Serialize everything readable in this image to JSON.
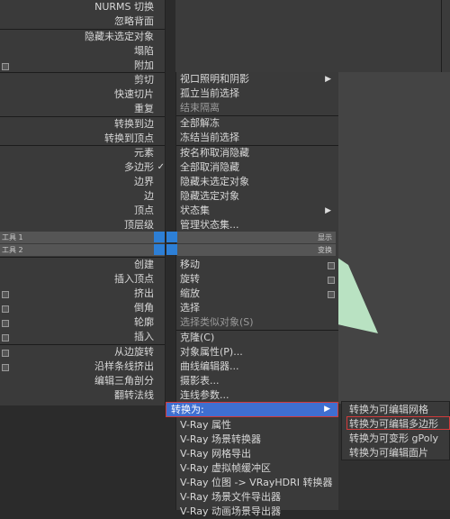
{
  "left_menu": {
    "items": [
      {
        "label": "NURMS 切换",
        "has_box": false
      },
      {
        "label": "忽略背面",
        "has_box": false
      },
      {
        "label": "隐藏未选定对象",
        "has_box": false
      },
      {
        "label": "塌陷",
        "has_box": false
      },
      {
        "label": "附加",
        "has_box": true
      },
      {
        "label": "剪切",
        "has_box": false
      },
      {
        "label": "快速切片",
        "has_box": false
      },
      {
        "label": "重复",
        "has_box": false
      },
      {
        "label": "转换到边",
        "has_box": false
      },
      {
        "label": "转换到顶点",
        "has_box": false
      },
      {
        "label": "元素",
        "has_box": false
      },
      {
        "label": "多边形",
        "has_box": false,
        "checked": true
      },
      {
        "label": "边界",
        "has_box": false
      },
      {
        "label": "边",
        "has_box": false
      },
      {
        "label": "顶点",
        "has_box": false
      },
      {
        "label": "顶层级",
        "has_box": false
      },
      {
        "label": "创建",
        "has_box": false
      },
      {
        "label": "插入顶点",
        "has_box": false
      },
      {
        "label": "挤出",
        "has_box": true
      },
      {
        "label": "倒角",
        "has_box": true
      },
      {
        "label": "轮廓",
        "has_box": true
      },
      {
        "label": "插入",
        "has_box": true
      },
      {
        "label": "从边旋转",
        "has_box": true
      },
      {
        "label": "沿样条线挤出",
        "has_box": true
      },
      {
        "label": "编辑三角剖分",
        "has_box": false
      },
      {
        "label": "翻转法线",
        "has_box": false
      }
    ],
    "check_mark": "✓"
  },
  "quad_bars": {
    "tools1_left": "工具 1",
    "tools1_right": "显示",
    "tools2_left": "工具 2",
    "tools2_right": "变换"
  },
  "right_menu": {
    "items": [
      {
        "label": "视口照明和阴影",
        "arrow": true
      },
      {
        "label": "孤立当前选择"
      },
      {
        "label": "结束隔离",
        "disabled": true
      },
      {
        "label": "全部解冻"
      },
      {
        "label": "冻结当前选择"
      },
      {
        "label": "按名称取消隐藏"
      },
      {
        "label": "全部取消隐藏"
      },
      {
        "label": "隐藏未选定对象"
      },
      {
        "label": "隐藏选定对象"
      },
      {
        "label": "状态集",
        "arrow": true
      },
      {
        "label": "管理状态集..."
      },
      {
        "label": "移动",
        "has_box": true
      },
      {
        "label": "旋转",
        "has_box": true
      },
      {
        "label": "缩放",
        "has_box": true
      },
      {
        "label": "选择"
      },
      {
        "label": "选择类似对象(S)",
        "disabled": true
      },
      {
        "label": "克隆(C)"
      },
      {
        "label": "对象属性(P)..."
      },
      {
        "label": "曲线编辑器..."
      },
      {
        "label": "摄影表..."
      },
      {
        "label": "连线参数..."
      }
    ],
    "arrow_glyph": "▶"
  },
  "convert_row": {
    "label": "转换为:",
    "arrow": "▶"
  },
  "bottom_menu": {
    "items": [
      {
        "label": "V-Ray 属性"
      },
      {
        "label": "V-Ray 场景转换器"
      },
      {
        "label": "V-Ray 网格导出"
      },
      {
        "label": "V-Ray 虚拟帧缓冲区"
      },
      {
        "label": "V-Ray 位图 -> VRayHDRI 转换器"
      },
      {
        "label": "V-Ray 场景文件导出器"
      },
      {
        "label": "V-Ray 动画场景导出器"
      }
    ]
  },
  "submenu": {
    "items": [
      {
        "label": "转换为可编辑网格"
      },
      {
        "label": "转换为可编辑多边形",
        "highlight": true
      },
      {
        "label": "转换为可变形 gPoly"
      },
      {
        "label": "转换为可编辑面片"
      }
    ]
  },
  "colors": {
    "accent": "#3f6fd1",
    "highlight_border": "#d23b3b",
    "shape": "#b9e2c2"
  }
}
